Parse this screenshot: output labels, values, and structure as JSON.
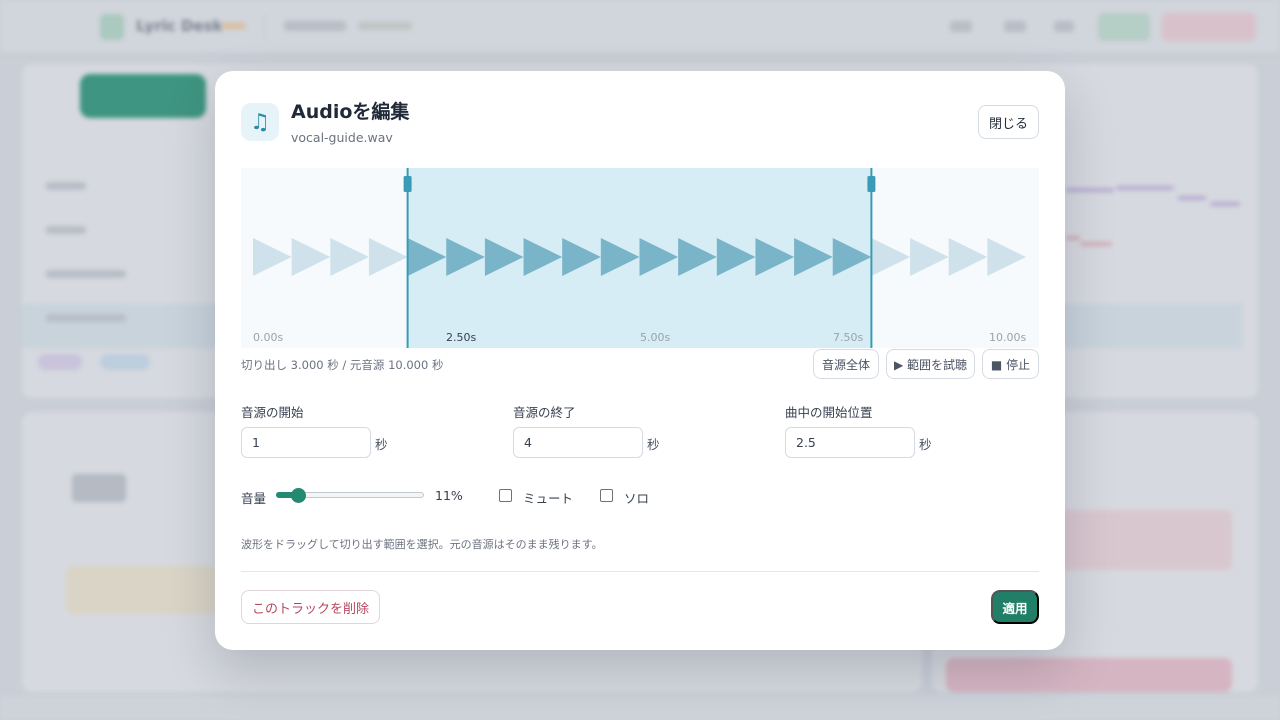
{
  "dialog": {
    "title": "Audioを編集",
    "file_name": "vocal-guide.wav",
    "close_label": "閉じる",
    "icon": "music-note-icon"
  },
  "waveform": {
    "duration_seconds": 10,
    "selection_start_seconds": 2,
    "selection_end_seconds": 8,
    "ticks": [
      "0.00s",
      "2.50s",
      "5.00s",
      "7.50s",
      "10.00s"
    ],
    "accent_color": "#3a9bb8",
    "selection_color": "#d7edf5"
  },
  "info": {
    "summary": "切り出し 3.000 秒 / 元音源 10.000 秒",
    "full_label": "音源全体",
    "play_label": "▶ 範囲を試聴",
    "stop_label": "■ 停止"
  },
  "fields": {
    "source_start": {
      "label": "音源の開始",
      "value": "1",
      "unit": "秒"
    },
    "source_end": {
      "label": "音源の終了",
      "value": "4",
      "unit": "秒"
    },
    "song_start": {
      "label": "曲中の開始位置",
      "value": "2.5",
      "unit": "秒"
    }
  },
  "volume": {
    "label": "音量",
    "value_text": "11%",
    "value": 0.11
  },
  "mute": {
    "label": "ミュート",
    "checked": false
  },
  "solo": {
    "label": "ソロ",
    "checked": false
  },
  "hint": "波形をドラッグして切り出す範囲を選択。元の音源はそのまま残ります。",
  "actions": {
    "delete_label": "このトラックを削除",
    "apply_label": "適用"
  },
  "background_app": {
    "logo_text": "Lyric Desk"
  }
}
